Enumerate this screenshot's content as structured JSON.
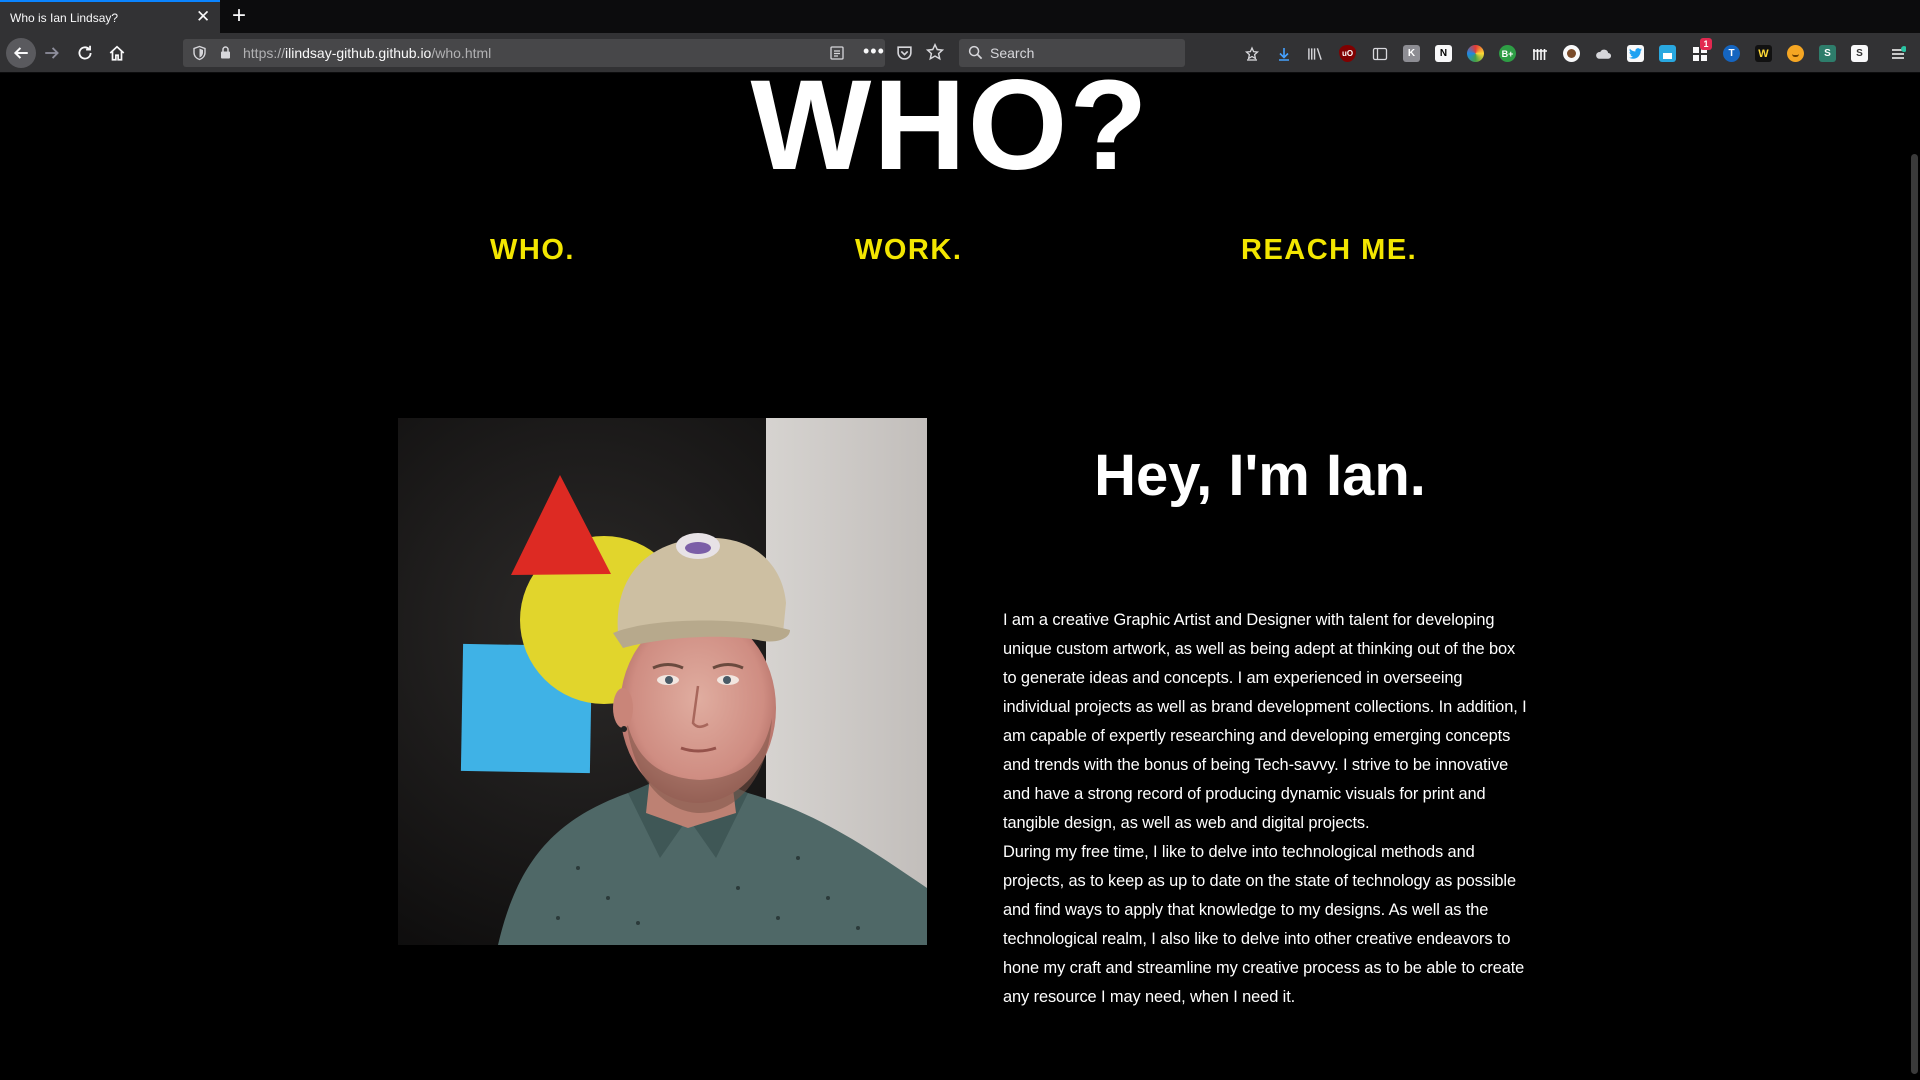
{
  "browser": {
    "tab_title": "Who is Ian Lindsay?",
    "tab_close_glyph": "✕",
    "new_tab_glyph": "+",
    "url_scheme": "https://",
    "url_domain": "ilindsay-github.github.io",
    "url_path": "/who.html",
    "more_actions_glyph": "•••",
    "search_placeholder": "Search",
    "toolbar_icons": [
      "downloads-save-icon",
      "download-arrow-icon",
      "library-icon",
      "ublock-icon",
      "sidebar-icon",
      "k-extension-icon",
      "w-extension-icon",
      "color-extension-icon",
      "b-extension-icon",
      "bars-extension-icon",
      "circle-extension-icon",
      "cloud-extension-icon",
      "twitter-extension-icon",
      "save-extension-icon",
      "grid-extension-icon",
      "t-extension-icon",
      "w2-extension-icon",
      "face-extension-icon",
      "s-extension-icon",
      "s2-extension-icon",
      "menu-icon"
    ],
    "badge_count": "1"
  },
  "page": {
    "title": "WHO?",
    "nav": {
      "who": "WHO.",
      "work": "WORK.",
      "reach": "REACH ME."
    },
    "intro_heading": "Hey, I'm Ian.",
    "bio": [
      "I am a creative Graphic Artist and Designer with talent for developing unique custom artwork, as well as being adept at thinking out of the box to generate ideas and concepts. I am experienced in overseeing individual projects as well as brand development collections. In addition, I am capable of expertly researching and developing emerging concepts and trends with the bonus of being Tech-savvy. I strive to be innovative and have a strong record of producing dynamic visuals for print and tangible design, as well as web and digital projects.",
      "During my free time, I like to delve into technological methods and projects, as to keep as up to date on the state of technology as possible and find ways to apply that knowledge to my designs. As well as the technological realm, I also like to delve into other creative endeavors to hone my craft and streamline my creative process as to be able to create any resource I may need, when I need it."
    ]
  },
  "colors": {
    "background": "#000000",
    "nav_link": "#f3e600",
    "heading": "#ffffff",
    "chrome_dark": "#0c0c0d",
    "chrome": "#323234",
    "accent_blue": "#0a84ff"
  }
}
